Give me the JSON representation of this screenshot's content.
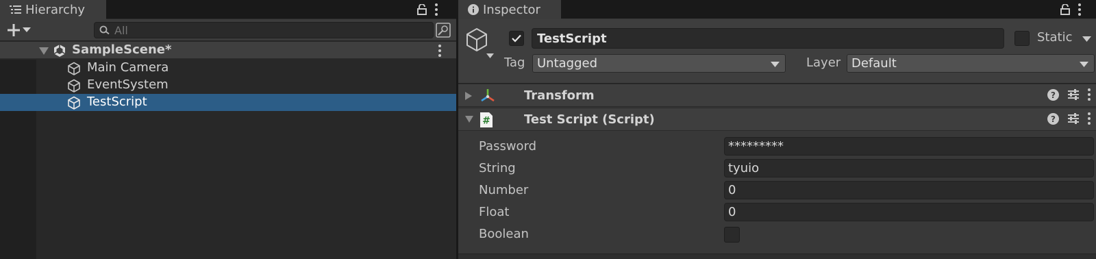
{
  "hierarchy": {
    "tab_label": "Hierarchy",
    "search": {
      "placeholder": "All",
      "value": ""
    },
    "scene": {
      "name": "SampleScene*"
    },
    "items": [
      {
        "label": "Main Camera",
        "selected": false
      },
      {
        "label": "EventSystem",
        "selected": false
      },
      {
        "label": "TestScript",
        "selected": true
      }
    ]
  },
  "inspector": {
    "tab_label": "Inspector",
    "object": {
      "name": "TestScript",
      "active": true,
      "static_label": "Static",
      "static": false,
      "tag_label": "Tag",
      "tag_value": "Untagged",
      "layer_label": "Layer",
      "layer_value": "Default"
    },
    "components": [
      {
        "title": "Transform",
        "expanded": false,
        "icon": "transform-icon"
      },
      {
        "title": "Test Script (Script)",
        "expanded": true,
        "icon": "csharp-script-icon"
      }
    ],
    "properties": [
      {
        "label": "Password",
        "type": "text",
        "value": "*********"
      },
      {
        "label": "String",
        "type": "text",
        "value": "tyuio"
      },
      {
        "label": "Number",
        "type": "text",
        "value": "0"
      },
      {
        "label": "Float",
        "type": "text",
        "value": "0"
      },
      {
        "label": "Boolean",
        "type": "checkbox",
        "value": false
      }
    ]
  },
  "colors": {
    "selection": "#2c5d87",
    "panel_bg": "#282828",
    "inspector_bg": "#383838"
  }
}
